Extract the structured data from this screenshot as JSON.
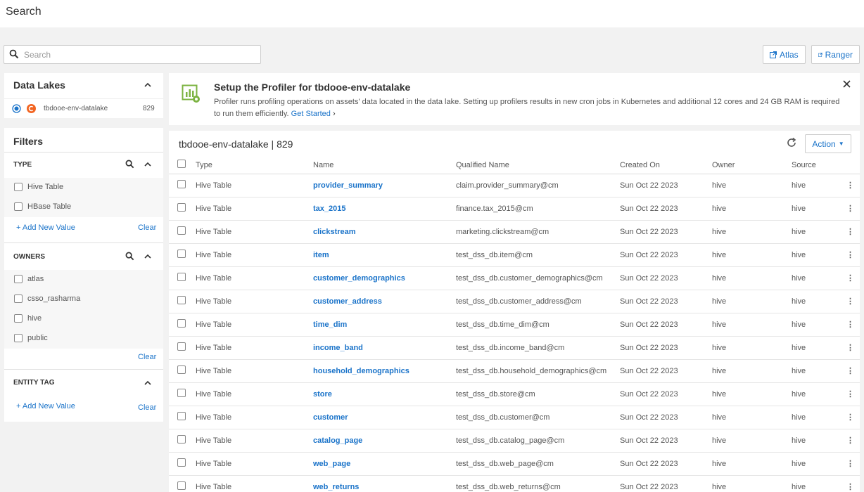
{
  "page": {
    "title": "Search"
  },
  "search": {
    "placeholder": "Search",
    "value": ""
  },
  "external_links": [
    {
      "label": "Atlas",
      "icon": "external-link-icon"
    },
    {
      "label": "Ranger",
      "icon": "external-link-icon"
    }
  ],
  "data_lakes": {
    "heading": "Data Lakes",
    "items": [
      {
        "name": "tbdooe-env-datalake",
        "count": "829",
        "selected": true
      }
    ]
  },
  "filters": {
    "heading": "Filters",
    "type": {
      "heading": "TYPE",
      "options": [
        "Hive Table",
        "HBase Table"
      ],
      "add_label": "+ Add New Value",
      "clear_label": "Clear"
    },
    "owners": {
      "heading": "OWNERS",
      "options": [
        "atlas",
        "csso_rasharma",
        "hive",
        "public"
      ],
      "clear_label": "Clear"
    },
    "entity_tag": {
      "heading": "ENTITY TAG",
      "add_label": "+ Add New Value",
      "clear_label": "Clear"
    }
  },
  "banner": {
    "title": "Setup the Profiler for tbdooe-env-datalake",
    "text": "Profiler runs profiling operations on assets' data located in the data lake. Setting up profilers results in new cron jobs in Kubernetes and additional 12 cores and 24 GB RAM is required to run them efficiently.",
    "link": "Get Started"
  },
  "results": {
    "title": "tbdooe-env-datalake | 829",
    "action_label": "Action",
    "columns": [
      "Type",
      "Name",
      "Qualified Name",
      "Created On",
      "Owner",
      "Source"
    ],
    "rows": [
      [
        "Hive Table",
        "provider_summary",
        "claim.provider_summary@cm",
        "Sun Oct 22 2023",
        "hive",
        "hive"
      ],
      [
        "Hive Table",
        "tax_2015",
        "finance.tax_2015@cm",
        "Sun Oct 22 2023",
        "hive",
        "hive"
      ],
      [
        "Hive Table",
        "clickstream",
        "marketing.clickstream@cm",
        "Sun Oct 22 2023",
        "hive",
        "hive"
      ],
      [
        "Hive Table",
        "item",
        "test_dss_db.item@cm",
        "Sun Oct 22 2023",
        "hive",
        "hive"
      ],
      [
        "Hive Table",
        "customer_demographics",
        "test_dss_db.customer_demographics@cm",
        "Sun Oct 22 2023",
        "hive",
        "hive"
      ],
      [
        "Hive Table",
        "customer_address",
        "test_dss_db.customer_address@cm",
        "Sun Oct 22 2023",
        "hive",
        "hive"
      ],
      [
        "Hive Table",
        "time_dim",
        "test_dss_db.time_dim@cm",
        "Sun Oct 22 2023",
        "hive",
        "hive"
      ],
      [
        "Hive Table",
        "income_band",
        "test_dss_db.income_band@cm",
        "Sun Oct 22 2023",
        "hive",
        "hive"
      ],
      [
        "Hive Table",
        "household_demographics",
        "test_dss_db.household_demographics@cm",
        "Sun Oct 22 2023",
        "hive",
        "hive"
      ],
      [
        "Hive Table",
        "store",
        "test_dss_db.store@cm",
        "Sun Oct 22 2023",
        "hive",
        "hive"
      ],
      [
        "Hive Table",
        "customer",
        "test_dss_db.customer@cm",
        "Sun Oct 22 2023",
        "hive",
        "hive"
      ],
      [
        "Hive Table",
        "catalog_page",
        "test_dss_db.catalog_page@cm",
        "Sun Oct 22 2023",
        "hive",
        "hive"
      ],
      [
        "Hive Table",
        "web_page",
        "test_dss_db.web_page@cm",
        "Sun Oct 22 2023",
        "hive",
        "hive"
      ],
      [
        "Hive Table",
        "web_returns",
        "test_dss_db.web_returns@cm",
        "Sun Oct 22 2023",
        "hive",
        "hive"
      ]
    ]
  },
  "colors": {
    "accent": "#1a73c9",
    "lake_icon": "#f26522",
    "banner_icon": "#7cb342"
  }
}
